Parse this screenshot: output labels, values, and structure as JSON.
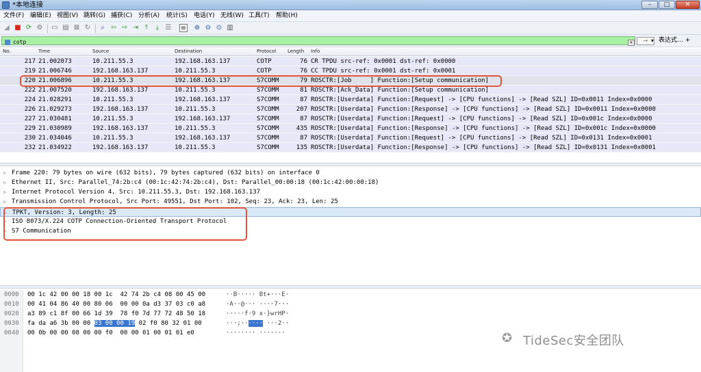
{
  "window": {
    "title": "*本地连接",
    "controls": [
      "–",
      "□",
      "✕"
    ]
  },
  "menu": [
    "文件(F)",
    "编辑(E)",
    "视图(V)",
    "跳转(G)",
    "捕获(C)",
    "分析(A)",
    "统计(S)",
    "电话(Y)",
    "无线(W)",
    "工具(T)",
    "帮助(H)"
  ],
  "filter": {
    "value": "cotp",
    "apply_label": "→",
    "expression_label": "表达式…",
    "plus_label": "+"
  },
  "columns": [
    "No.",
    "Time",
    "Source",
    "Destination",
    "Protocol",
    "Length",
    "Info"
  ],
  "packets": [
    {
      "no": "217",
      "time": "21.002073",
      "src": "10.211.55.3",
      "dst": "192.168.163.137",
      "proto": "COTP",
      "len": "76",
      "info": "CR TPDU src-ref: 0x0001 dst-ref: 0x0000"
    },
    {
      "no": "219",
      "time": "21.006746",
      "src": "192.168.163.137",
      "dst": "10.211.55.3",
      "proto": "COTP",
      "len": "76",
      "info": "CC TPDU src-ref: 0x0001 dst-ref: 0x0001"
    },
    {
      "no": "220",
      "time": "21.006896",
      "src": "10.211.55.3",
      "dst": "192.168.163.137",
      "proto": "S7COMM",
      "len": "79",
      "info": "ROSCTR:[Job     ] Function:[Setup communication]"
    },
    {
      "no": "222",
      "time": "21.007520",
      "src": "192.168.163.137",
      "dst": "10.211.55.3",
      "proto": "S7COMM",
      "len": "81",
      "info": "ROSCTR:[Ack_Data] Function:[Setup communication]"
    },
    {
      "no": "224",
      "time": "21.028291",
      "src": "10.211.55.3",
      "dst": "192.168.163.137",
      "proto": "S7COMM",
      "len": "87",
      "info": "ROSCTR:[Userdata] Function:[Request] -> [CPU functions] -> [Read SZL] ID=0x0011 Index=0x0000"
    },
    {
      "no": "226",
      "time": "21.029273",
      "src": "192.168.163.137",
      "dst": "10.211.55.3",
      "proto": "S7COMM",
      "len": "207",
      "info": "ROSCTR:[Userdata] Function:[Response] -> [CPU functions] -> [Read SZL] ID=0x0011 Index=0x0000"
    },
    {
      "no": "227",
      "time": "21.030481",
      "src": "10.211.55.3",
      "dst": "192.168.163.137",
      "proto": "S7COMM",
      "len": "87",
      "info": "ROSCTR:[Userdata] Function:[Request] -> [CPU functions] -> [Read SZL] ID=0x001c Index=0x0000"
    },
    {
      "no": "229",
      "time": "21.030989",
      "src": "192.168.163.137",
      "dst": "10.211.55.3",
      "proto": "S7COMM",
      "len": "435",
      "info": "ROSCTR:[Userdata] Function:[Response] -> [CPU functions] -> [Read SZL] ID=0x001c Index=0x0000"
    },
    {
      "no": "230",
      "time": "21.034046",
      "src": "10.211.55.3",
      "dst": "192.168.163.137",
      "proto": "S7COMM",
      "len": "87",
      "info": "ROSCTR:[Userdata] Function:[Request] -> [CPU functions] -> [Read SZL] ID=0x0131 Index=0x0001"
    },
    {
      "no": "232",
      "time": "21.034922",
      "src": "192.168.163.137",
      "dst": "10.211.55.3",
      "proto": "S7COMM",
      "len": "135",
      "info": "ROSCTR:[Userdata] Function:[Response] -> [CPU functions] -> [Read SZL] ID=0x0131 Index=0x0001"
    }
  ],
  "details": [
    "Frame 220: 79 bytes on wire (632 bits), 79 bytes captured (632 bits) on interface 0",
    "Ethernet II, Src: Parallel_74:2b:c4 (00:1c:42:74:2b:c4), Dst: Parallel_00:00:18 (00:1c:42:00:00:18)",
    "Internet Protocol Version 4, Src: 10.211.55.3, Dst: 192.168.163.137",
    "Transmission Control Protocol, Src Port: 49551, Dst Port: 102, Seq: 23, Ack: 23, Len: 25",
    "TPKT, Version: 3, Length: 25",
    "ISO 8073/X.224 COTP Connection-Oriented Transport Protocol",
    "S7 Communication"
  ],
  "bytes": [
    {
      "offset": "0000",
      "hex_a": "00 1c 42 00 00 18 00 1c  42 74 2b c4 08 00 45 00",
      "hex_sel": "",
      "hex_b": "",
      "ascii_a": "··B····· Bt+···E·",
      "ascii_sel": "",
      "ascii_b": ""
    },
    {
      "offset": "0010",
      "hex_a": "00 41 04 86 40 00 80 06  00 00 0a d3 37 03 c0 a8",
      "hex_sel": "",
      "hex_b": "",
      "ascii_a": "·A··@··· ····7···",
      "ascii_sel": "",
      "ascii_b": ""
    },
    {
      "offset": "0020",
      "hex_a": "a3 89 c1 8f 00 66 1d 39  78 f0 7d 77 72 48 50 18",
      "hex_sel": "",
      "hex_b": "",
      "ascii_a": "·····f·9 x·}wrHP·",
      "ascii_sel": "",
      "ascii_b": ""
    },
    {
      "offset": "0030",
      "hex_a": "fa da a6 3b 00 00 ",
      "hex_sel": "03 00 00 19",
      "hex_b": " 02 f0 80 32 01 00",
      "ascii_a": "···;··",
      "ascii_sel": "····",
      "ascii_b": " ···2··"
    },
    {
      "offset": "0040",
      "hex_a": "00 0b 00 00 08 00 00 f0  00 00 01 00 01 01 e0",
      "hex_sel": "",
      "hex_b": "",
      "ascii_a": "········ ·······",
      "ascii_sel": "",
      "ascii_b": ""
    }
  ],
  "watermark": "TideSec安全团队",
  "colors": {
    "filter_bg": "#a9f0a4",
    "row_bg": "#e6e8f7",
    "annotation": "#e0553a",
    "hex_highlight": "#3a75cf"
  }
}
